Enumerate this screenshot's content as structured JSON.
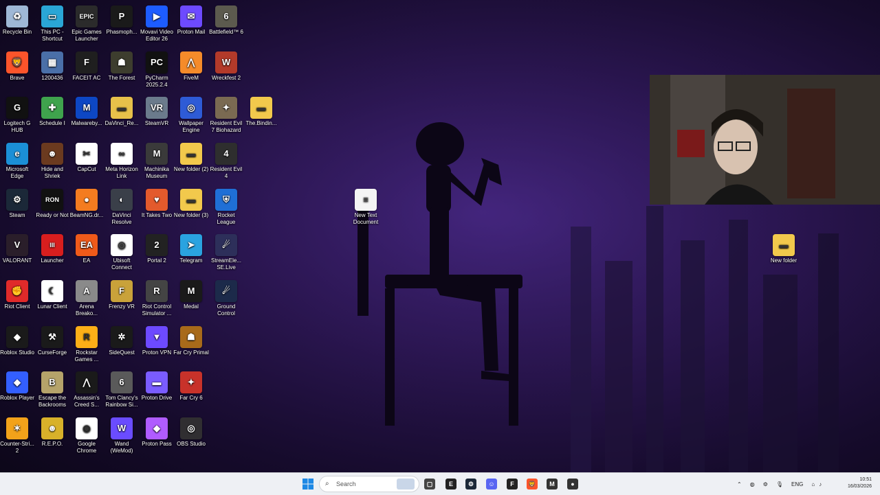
{
  "desktop": {
    "icons": [
      {
        "label": "Recycle Bin",
        "icon": "recycle-bin-icon",
        "color": "#9fb8d6",
        "glyph": "♻"
      },
      {
        "label": "This PC - Shortcut",
        "icon": "monitor-icon",
        "color": "#2aa6d6",
        "glyph": "▭"
      },
      {
        "label": "Epic Games Launcher",
        "icon": "epic-games-icon",
        "color": "#2b2b2b",
        "glyph": "EPIC"
      },
      {
        "label": "Phasmoph...",
        "icon": "phasmophobia-icon",
        "color": "#1a1a1a",
        "glyph": "P"
      },
      {
        "label": "Movavi Video Editor 26",
        "icon": "movavi-icon",
        "color": "#1d5cff",
        "glyph": "▶"
      },
      {
        "label": "Proton Mail",
        "icon": "proton-mail-icon",
        "color": "#6d4aff",
        "glyph": "✉"
      },
      {
        "label": "Battlefield™ 6",
        "icon": "battlefield-icon",
        "color": "#5c5a4e",
        "glyph": "6"
      },
      {
        "label": "Brave",
        "icon": "brave-icon",
        "color": "#fb542b",
        "glyph": "🦁"
      },
      {
        "label": "1200436",
        "icon": "image-file-icon",
        "color": "#4a6fa8",
        "glyph": "▦"
      },
      {
        "label": "FACEIT AC",
        "icon": "faceit-icon",
        "color": "#1f1f1f",
        "glyph": "F"
      },
      {
        "label": "The Forest",
        "icon": "the-forest-icon",
        "color": "#3d3d2e",
        "glyph": "☗"
      },
      {
        "label": "PyCharm 2025.2.4",
        "icon": "pycharm-icon",
        "color": "#111",
        "glyph": "PC"
      },
      {
        "label": "FiveM",
        "icon": "fivem-icon",
        "color": "#f58b2a",
        "glyph": "⋀"
      },
      {
        "label": "Wreckfest 2",
        "icon": "wreckfest-icon",
        "color": "#b33a2a",
        "glyph": "W"
      },
      {
        "label": "Logitech G HUB",
        "icon": "logitech-icon",
        "color": "#111",
        "glyph": "G"
      },
      {
        "label": "Schedule I",
        "icon": "schedule-icon",
        "color": "#3fa34d",
        "glyph": "✚"
      },
      {
        "label": "Malwareby...",
        "icon": "malwarebytes-icon",
        "color": "#0d47c4",
        "glyph": "M"
      },
      {
        "label": "DaVinci_Re...",
        "icon": "folder-icon",
        "color": "#e7c14a",
        "glyph": "▬"
      },
      {
        "label": "SteamVR",
        "icon": "steamvr-icon",
        "color": "#6b7b8c",
        "glyph": "VR"
      },
      {
        "label": "Wallpaper Engine",
        "icon": "wallpaper-engine-icon",
        "color": "#2e5bd6",
        "glyph": "◎"
      },
      {
        "label": "Resident Evil 7 Biohazard",
        "icon": "resident-evil-7-icon",
        "color": "#7a6a52",
        "glyph": "✦"
      },
      {
        "label": "The.Bindin...",
        "icon": "folder-icon",
        "color": "#f2c94c",
        "glyph": "▬"
      },
      {
        "label": "Microsoft Edge",
        "icon": "edge-icon",
        "color": "#1b8fd6",
        "glyph": "e"
      },
      {
        "label": "Hide and Shriek",
        "icon": "hide-and-shriek-icon",
        "color": "#6b3a1f",
        "glyph": "☻"
      },
      {
        "label": "CapCut",
        "icon": "capcut-icon",
        "color": "#fff",
        "glyph": "✂"
      },
      {
        "label": "Meta Horizon Link",
        "icon": "meta-icon",
        "color": "#fff",
        "glyph": "∞"
      },
      {
        "label": "Machinika Museum",
        "icon": "machinika-icon",
        "color": "#3a3a3a",
        "glyph": "M"
      },
      {
        "label": "New folder (2)",
        "icon": "folder-icon",
        "color": "#f2c94c",
        "glyph": "▬"
      },
      {
        "label": "Resident Evil 4",
        "icon": "resident-evil-4-icon",
        "color": "#2e2e2e",
        "glyph": "4"
      },
      {
        "label": "Steam",
        "icon": "steam-icon",
        "color": "#1b2838",
        "glyph": "⚙"
      },
      {
        "label": "Ready or Not",
        "icon": "ready-or-not-icon",
        "color": "#111",
        "glyph": "RON"
      },
      {
        "label": "BeamNG.dr...",
        "icon": "beamng-icon",
        "color": "#f47c20",
        "glyph": "●"
      },
      {
        "label": "DaVinci Resolve",
        "icon": "davinci-resolve-icon",
        "color": "#3a3f49",
        "glyph": "◐"
      },
      {
        "label": "It Takes Two",
        "icon": "it-takes-two-icon",
        "color": "#e35a2c",
        "glyph": "♥"
      },
      {
        "label": "New folder (3)",
        "icon": "folder-icon",
        "color": "#f2c94c",
        "glyph": "▬"
      },
      {
        "label": "Rocket League",
        "icon": "rocket-league-icon",
        "color": "#1f6fd6",
        "glyph": "⛨"
      },
      {
        "label": "VALORANT",
        "icon": "valorant-icon",
        "color": "#2a1e2a",
        "glyph": "V"
      },
      {
        "label": "Launcher",
        "icon": "launcher-icon",
        "color": "#d81e1e",
        "glyph": "III"
      },
      {
        "label": "EA",
        "icon": "ea-icon",
        "color": "#f05a1a",
        "glyph": "EA"
      },
      {
        "label": "Ubisoft Connect",
        "icon": "ubisoft-icon",
        "color": "#fff",
        "glyph": "◎"
      },
      {
        "label": "Portal 2",
        "icon": "portal-2-icon",
        "color": "#222",
        "glyph": "2"
      },
      {
        "label": "Telegram",
        "icon": "telegram-icon",
        "color": "#2aa3e0",
        "glyph": "➤"
      },
      {
        "label": "StreamEle... SE.Live",
        "icon": "streamelements-icon",
        "color": "#2d2f5a",
        "glyph": "☄"
      },
      {
        "label": "Riot Client",
        "icon": "riot-client-icon",
        "color": "#e02a2a",
        "glyph": "✊"
      },
      {
        "label": "Lunar Client",
        "icon": "lunar-client-icon",
        "color": "#fff",
        "glyph": "☾"
      },
      {
        "label": "Arena Breako...",
        "icon": "arena-breakout-icon",
        "color": "#8a8a8a",
        "glyph": "A"
      },
      {
        "label": "Frenzy VR",
        "icon": "frenzy-vr-icon",
        "color": "#c9a23a",
        "glyph": "F"
      },
      {
        "label": "Riot Control Simulator ...",
        "icon": "riot-control-icon",
        "color": "#444",
        "glyph": "R"
      },
      {
        "label": "Medal",
        "icon": "medal-icon",
        "color": "#1a1a1a",
        "glyph": "M"
      },
      {
        "label": "Ground Control",
        "icon": "ground-control-icon",
        "color": "#1c2a4a",
        "glyph": "☄"
      },
      {
        "label": "Roblox Studio",
        "icon": "roblox-studio-icon",
        "color": "#1a1a1a",
        "glyph": "◆"
      },
      {
        "label": "CurseForge",
        "icon": "curseforge-icon",
        "color": "#1a1a1a",
        "glyph": "⚒"
      },
      {
        "label": "Rockstar Games ...",
        "icon": "rockstar-icon",
        "color": "#fcaf17",
        "glyph": "R"
      },
      {
        "label": "SideQuest",
        "icon": "sidequest-icon",
        "color": "#1a1a1a",
        "glyph": "✲"
      },
      {
        "label": "Proton VPN",
        "icon": "proton-vpn-icon",
        "color": "#6d4aff",
        "glyph": "▼"
      },
      {
        "label": "Far Cry Primal",
        "icon": "far-cry-primal-icon",
        "color": "#a86a1a",
        "glyph": "☗"
      },
      {
        "label": "Roblox Player",
        "icon": "roblox-player-icon",
        "color": "#335fff",
        "glyph": "◆"
      },
      {
        "label": "Escape the Backrooms",
        "icon": "escape-backrooms-icon",
        "color": "#b5a36a",
        "glyph": "B"
      },
      {
        "label": "Assassin's Creed S...",
        "icon": "assassins-creed-icon",
        "color": "#1a1a1a",
        "glyph": "⋀"
      },
      {
        "label": "Tom Clancy's Rainbow Si...",
        "icon": "rainbow-six-icon",
        "color": "#5a5a5a",
        "glyph": "6"
      },
      {
        "label": "Proton Drive",
        "icon": "proton-drive-icon",
        "color": "#7a5cff",
        "glyph": "▬"
      },
      {
        "label": "Far Cry 6",
        "icon": "far-cry-6-icon",
        "color": "#c8322a",
        "glyph": "✦"
      },
      {
        "label": "Counter-Stri... 2",
        "icon": "counter-strike-icon",
        "color": "#f2a21a",
        "glyph": "✶"
      },
      {
        "label": "R.E.P.O.",
        "icon": "repo-icon",
        "color": "#d8b12a",
        "glyph": "☻"
      },
      {
        "label": "Google Chrome",
        "icon": "chrome-icon",
        "color": "#fff",
        "glyph": "◉"
      },
      {
        "label": "Wand (WeMod)",
        "icon": "wemod-icon",
        "color": "#6a4cff",
        "glyph": "W"
      },
      {
        "label": "Proton Pass",
        "icon": "proton-pass-icon",
        "color": "#b05cff",
        "glyph": "◆"
      },
      {
        "label": "OBS Studio",
        "icon": "obs-icon",
        "color": "#302e31",
        "glyph": "◎"
      },
      {
        "label": "New Text Document",
        "icon": "text-document-icon",
        "color": "#f4f4f4",
        "glyph": "≡"
      },
      {
        "label": "New folder",
        "icon": "folder-icon",
        "color": "#f2c94c",
        "glyph": "▬"
      }
    ]
  },
  "taskbar": {
    "search_placeholder": "Search",
    "pinned": [
      {
        "icon": "windows-start-icon",
        "color": "#1e88e5",
        "glyph": "⊞"
      },
      {
        "icon": "task-view-icon",
        "color": "#444",
        "glyph": "▢"
      },
      {
        "icon": "epic-games-taskbar-icon",
        "color": "#222",
        "glyph": "E"
      },
      {
        "icon": "steam-taskbar-icon",
        "color": "#1b2838",
        "glyph": "⚙"
      },
      {
        "icon": "discord-icon",
        "color": "#5865f2",
        "glyph": "☺"
      },
      {
        "icon": "faceit-taskbar-icon",
        "color": "#222",
        "glyph": "F"
      },
      {
        "icon": "brave-taskbar-icon",
        "color": "#fb542b",
        "glyph": "🦁"
      },
      {
        "icon": "proton-mail-taskbar-icon",
        "color": "#333",
        "glyph": "M"
      },
      {
        "icon": "recording-app-icon",
        "color": "#333",
        "glyph": "●"
      }
    ],
    "tray": {
      "language": "ENG",
      "time": "10:51",
      "date": "16/03/2026"
    }
  }
}
